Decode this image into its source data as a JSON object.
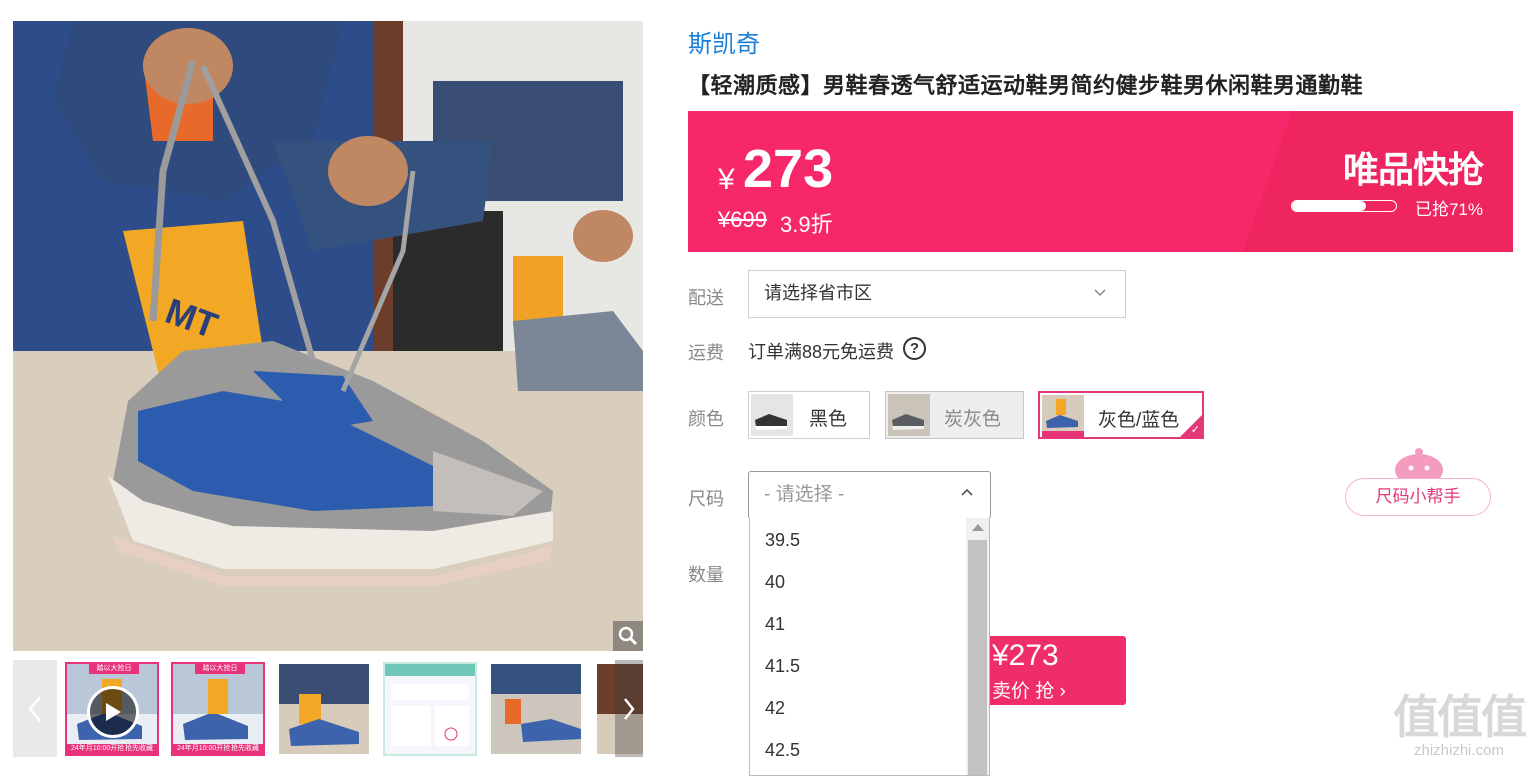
{
  "brand": "斯凯奇",
  "title": "【轻潮质感】男鞋春透气舒适运动鞋男简约健步鞋男休闲鞋男通勤鞋",
  "price_banner": {
    "currency": "¥",
    "price": "273",
    "original_price": "¥699",
    "discount": "3.9折",
    "flash_title": "唯品快抢",
    "progress_text": "已抢71%",
    "progress_fraction": 0.71
  },
  "delivery": {
    "label": "配送",
    "placeholder": "请选择省市区"
  },
  "shipping": {
    "label": "运费",
    "text": "订单满88元免运费",
    "help_icon": "question-circle-icon"
  },
  "color": {
    "label": "颜色",
    "options": [
      {
        "label": "黑色",
        "state": "default"
      },
      {
        "label": "炭灰色",
        "state": "unavailable"
      },
      {
        "label": "灰色/蓝色",
        "state": "selected"
      }
    ]
  },
  "size": {
    "label": "尺码",
    "placeholder": "- 请选择 -",
    "options": [
      "39.5",
      "40",
      "41",
      "41.5",
      "42",
      "42.5"
    ],
    "helper": "尺码小帮手"
  },
  "quantity": {
    "label": "数量"
  },
  "buy_button": {
    "price": "¥273",
    "label": "卖价 抢"
  },
  "watermark": {
    "logo": "值值值",
    "url": "zhizhizhi.com"
  },
  "thumbnails": {
    "banner_text": "踏以大抢日",
    "bottom_left": "24年月10:00开抢",
    "bottom_right": "抢先收藏"
  },
  "colors": {
    "brand_blue": "#1a7fd6",
    "banner_pink": "#f7286a",
    "accent_pink": "#e23779"
  }
}
